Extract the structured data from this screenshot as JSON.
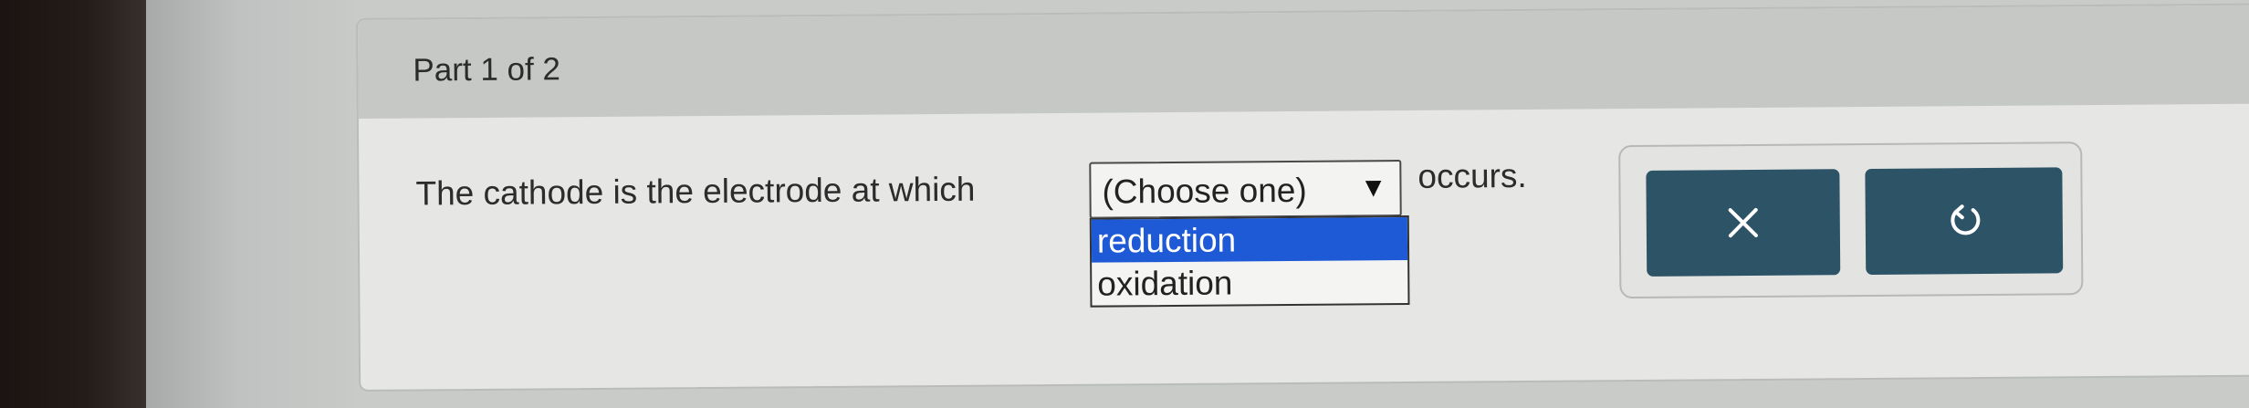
{
  "part": {
    "label": "Part 1 of 2"
  },
  "question": {
    "prefix": "The cathode is the electrode at which",
    "suffix": "occurs."
  },
  "dropdown": {
    "selected": "(Choose one)",
    "arrow": "▼",
    "options": [
      {
        "label": "reduction",
        "highlighted": true
      },
      {
        "label": "oxidation",
        "highlighted": false
      }
    ]
  },
  "tools": {
    "clear_icon": "x-icon",
    "undo_icon": "undo-icon"
  },
  "colors": {
    "button_bg": "#2d5466",
    "highlight": "#1f5ad6"
  }
}
